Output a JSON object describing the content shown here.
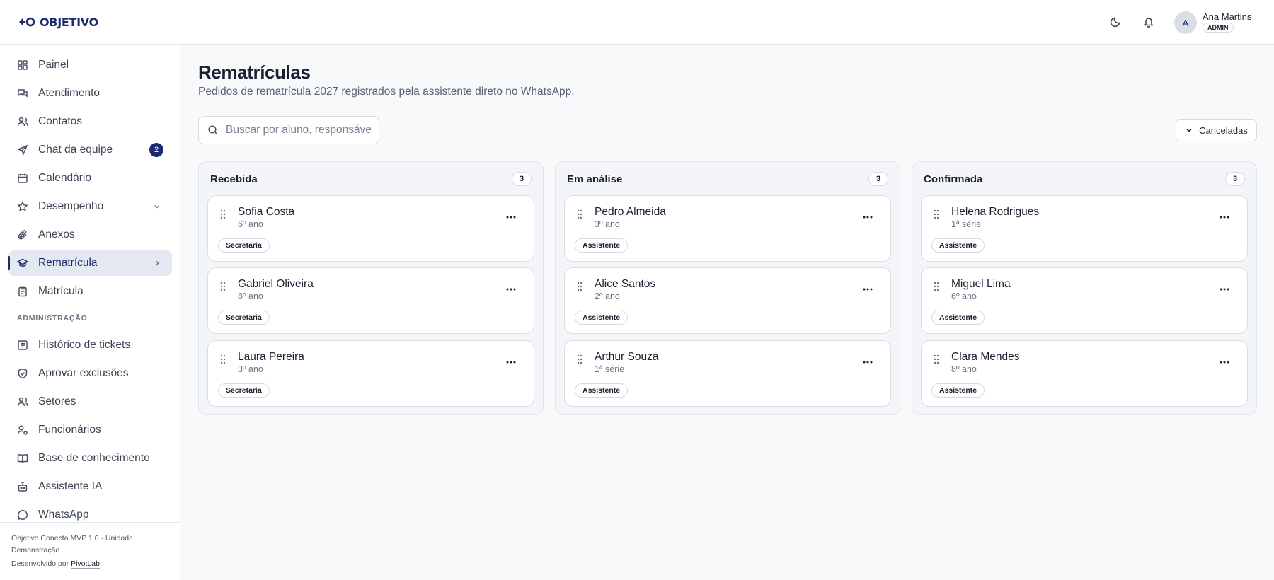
{
  "brand": {
    "logo_text": "OBJETIVO",
    "color": "#1a2a6c"
  },
  "sidebar": {
    "items": [
      {
        "label": "Painel",
        "icon": "dashboard-icon"
      },
      {
        "label": "Atendimento",
        "icon": "chat-bubbles-icon"
      },
      {
        "label": "Contatos",
        "icon": "users-icon"
      },
      {
        "label": "Chat da equipe",
        "icon": "send-icon",
        "badge": "2"
      },
      {
        "label": "Calendário",
        "icon": "calendar-icon"
      },
      {
        "label": "Desempenho",
        "icon": "star-icon",
        "trailing": "chevron-down-icon"
      },
      {
        "label": "Anexos",
        "icon": "paperclip-icon"
      },
      {
        "label": "Rematrícula",
        "icon": "graduation-cap-icon",
        "trailing": "chevron-right-icon",
        "active": true
      },
      {
        "label": "Matrícula",
        "icon": "clipboard-icon"
      }
    ],
    "section_label": "ADMINISTRAÇÃO",
    "admin_items": [
      {
        "label": "Histórico de tickets",
        "icon": "ticket-icon"
      },
      {
        "label": "Aprovar exclusões",
        "icon": "shield-check-icon"
      },
      {
        "label": "Setores",
        "icon": "users-icon"
      },
      {
        "label": "Funcionários",
        "icon": "user-cog-icon"
      },
      {
        "label": "Base de conhecimento",
        "icon": "book-icon"
      },
      {
        "label": "Assistente IA",
        "icon": "bot-icon"
      },
      {
        "label": "WhatsApp",
        "icon": "whatsapp-icon"
      }
    ],
    "footer": {
      "version": "Objetivo Conecta MVP 1.0 · Unidade Demonstração",
      "credit_prefix": "Desenvolvido por",
      "credit_link": "PivotLab"
    }
  },
  "header": {
    "user_initial": "A",
    "user_name": "Ana Martins",
    "user_role": "ADMIN"
  },
  "page": {
    "title": "Rematrículas",
    "subtitle": "Pedidos de rematrícula 2027 registrados pela assistente direto no WhatsApp.",
    "search_placeholder": "Buscar por aluno, responsável ou…",
    "filter_label": "Canceladas"
  },
  "board": {
    "columns": [
      {
        "title": "Recebida",
        "count": "3",
        "cards": [
          {
            "name": "Sofia Costa",
            "grade": "6º ano",
            "tag": "Secretaria"
          },
          {
            "name": "Gabriel Oliveira",
            "grade": "8º ano",
            "tag": "Secretaria"
          },
          {
            "name": "Laura Pereira",
            "grade": "3º ano",
            "tag": "Secretaria"
          }
        ]
      },
      {
        "title": "Em análise",
        "count": "3",
        "cards": [
          {
            "name": "Pedro Almeida",
            "grade": "3º ano",
            "tag": "Assistente"
          },
          {
            "name": "Alice Santos",
            "grade": "2º ano",
            "tag": "Assistente"
          },
          {
            "name": "Arthur Souza",
            "grade": "1ª série",
            "tag": "Assistente"
          }
        ]
      },
      {
        "title": "Confirmada",
        "count": "3",
        "cards": [
          {
            "name": "Helena Rodrigues",
            "grade": "1ª série",
            "tag": "Assistente"
          },
          {
            "name": "Miguel Lima",
            "grade": "6º ano",
            "tag": "Assistente"
          },
          {
            "name": "Clara Mendes",
            "grade": "8º ano",
            "tag": "Assistente"
          }
        ]
      }
    ]
  }
}
